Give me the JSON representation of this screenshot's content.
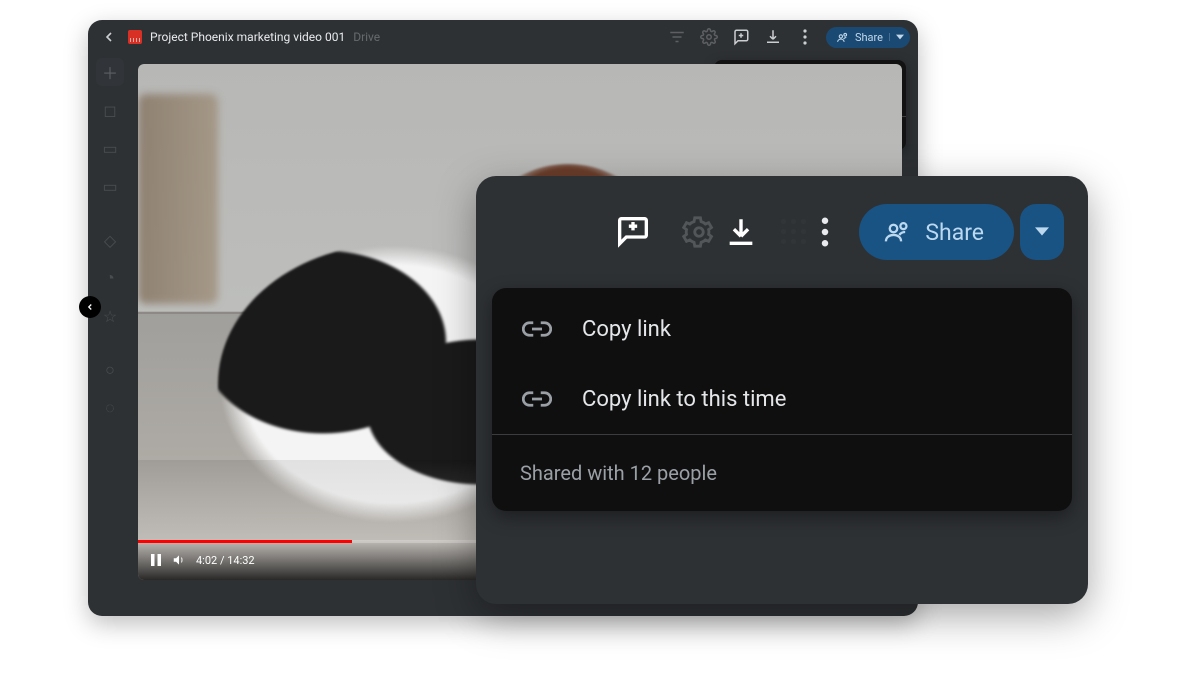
{
  "header": {
    "title": "Project Phoenix marketing video 001",
    "context_hint": "Drive",
    "share_label": "Share"
  },
  "toolbar_icons": {
    "back": "arrow-back",
    "add_comment": "add-comment",
    "download": "download",
    "more": "more-vert"
  },
  "share_menu": {
    "items": [
      "Copy link",
      "Copy link to this time"
    ],
    "footer": "Shared with 12 people"
  },
  "player": {
    "state": "paused",
    "current_time": "4:02",
    "duration": "14:32",
    "time_display": "4:02 / 14:32",
    "progress_percent": 28
  },
  "rail": {
    "plus": "+"
  },
  "colors": {
    "share_blue": "#185384",
    "accent_red": "#ff0000"
  }
}
